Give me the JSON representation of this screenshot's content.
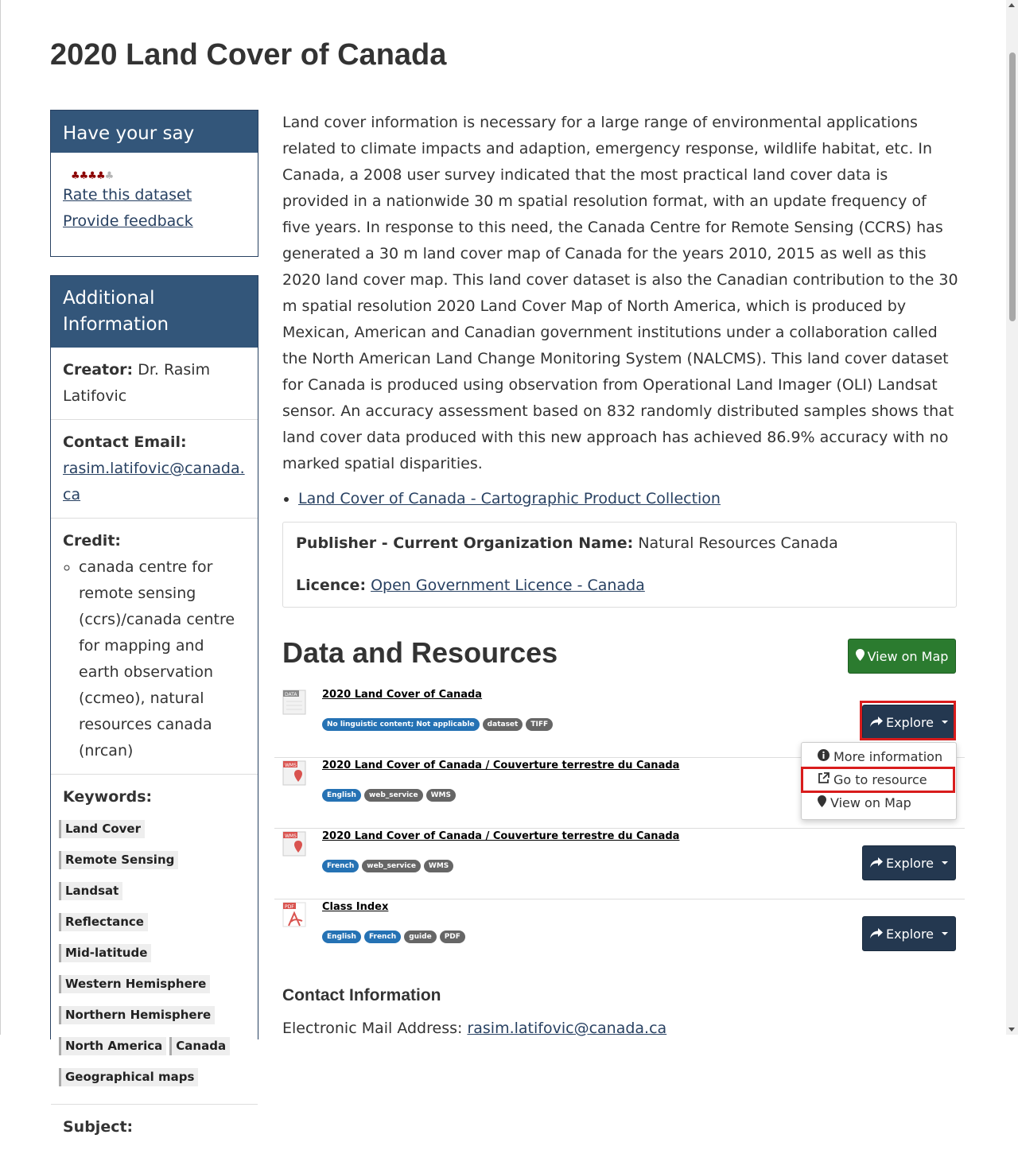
{
  "page": {
    "title": "2020 Land Cover of Canada"
  },
  "have_your_say": {
    "heading": "Have your say",
    "rating_stars": 4,
    "rating_max": 5,
    "rate_link": "Rate this dataset",
    "feedback_link": "Provide feedback"
  },
  "additional_info": {
    "heading": "Additional Information",
    "creator_label": "Creator:",
    "creator_value": "Dr. Rasim Latifovic",
    "email_label": "Contact Email:",
    "email_value": "rasim.latifovic@canada.ca",
    "credit_label": "Credit:",
    "credit_items": [
      "canada centre for remote sensing (ccrs)/canada centre for mapping and earth observation (ccmeo), natural resources canada (nrcan)"
    ],
    "keywords_label": "Keywords:",
    "keywords": [
      "Land Cover",
      "Remote Sensing",
      "Landsat",
      "Reflectance",
      "Mid-latitude",
      "Western Hemisphere",
      "Northern Hemisphere",
      "North America",
      "Canada",
      "Geographical maps"
    ],
    "subject_label": "Subject:"
  },
  "description": "Land cover information is necessary for a large range of environmental applications related to climate impacts and adaption, emergency response, wildlife habitat, etc. In Canada, a 2008 user survey indicated that the most practical land cover data is provided in a nationwide 30 m spatial resolution format, with an update frequency of five years. In response to this need, the Canada Centre for Remote Sensing (CCRS) has generated a 30 m land cover map of Canada for the years 2010, 2015 as well as this 2020 land cover map. This land cover dataset is also the Canadian contribution to the 30 m spatial resolution 2020 Land Cover Map of North America, which is produced by Mexican, American and Canadian government institutions under a collaboration called the North American Land Change Monitoring System (NALCMS). This land cover dataset for Canada is produced using observation from Operational Land Imager (OLI) Landsat sensor. An accuracy assessment based on 832 randomly distributed samples shows that land cover data produced with this new approach has achieved 86.9% accuracy with no marked spatial disparities.",
  "collection_link": "Land Cover of Canada - Cartographic Product Collection",
  "publisher": {
    "label": "Publisher - Current Organization Name:",
    "value": "Natural Resources Canada",
    "licence_label": "Licence:",
    "licence_link": "Open Government Licence - Canada"
  },
  "data_resources": {
    "heading": "Data and Resources",
    "view_map_button": "View on Map",
    "explore_label": "Explore",
    "items": [
      {
        "icon": "DATA",
        "title": "2020 Land Cover of Canada",
        "tags": [
          "No linguistic content; Not applicable",
          "dataset",
          "TIFF"
        ]
      },
      {
        "icon": "WMS",
        "title": "2020 Land Cover of Canada / Couverture terrestre du Canada",
        "tags": [
          "English",
          "web_service",
          "WMS"
        ]
      },
      {
        "icon": "WMS",
        "title": "2020 Land Cover of Canada / Couverture terrestre du Canada",
        "tags": [
          "French",
          "web_service",
          "WMS"
        ]
      },
      {
        "icon": "PDF",
        "title": "Class Index",
        "tags": [
          "English",
          "French",
          "guide",
          "PDF"
        ]
      }
    ],
    "dropdown": {
      "more_info": "More information",
      "go_to_resource": "Go to resource",
      "view_on_map": "View on Map"
    }
  },
  "contact": {
    "heading": "Contact Information",
    "email_label": "Electronic Mail Address:",
    "email_value": "rasim.latifovic@canada.ca"
  },
  "colors": {
    "panel_heading": "#33567a",
    "explore_button": "#243850",
    "map_button": "#2b7b2f",
    "highlight": "#d91c1c",
    "tag_blue": "#2572b4",
    "tag_grey": "#666666"
  }
}
